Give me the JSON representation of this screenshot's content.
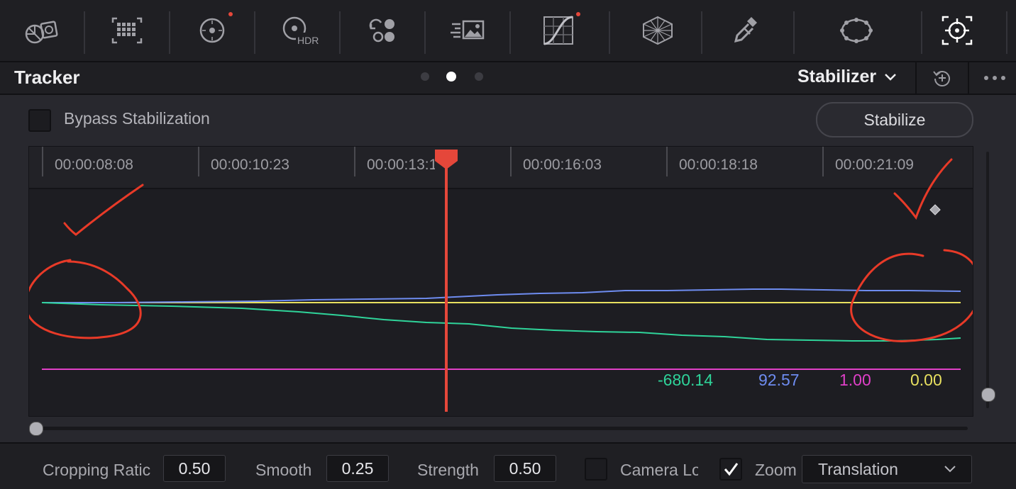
{
  "toolbar": {
    "tools": [
      {
        "icon": "camera-raw-icon",
        "badge": false
      },
      {
        "icon": "color-match-icon",
        "badge": false
      },
      {
        "icon": "color-wheels-icon",
        "badge": true
      },
      {
        "icon": "hdr-wheels-icon",
        "badge": false,
        "label": "HDR"
      },
      {
        "icon": "rgb-mixer-icon",
        "badge": false
      },
      {
        "icon": "motion-effects-icon",
        "badge": false
      },
      {
        "icon": "curves-icon",
        "badge": true
      },
      {
        "icon": "color-warper-icon",
        "badge": false
      },
      {
        "icon": "qualifier-icon",
        "badge": false
      },
      {
        "icon": "window-icon",
        "badge": false
      },
      {
        "icon": "tracker-icon",
        "badge": false,
        "active": true
      }
    ]
  },
  "header": {
    "title": "Tracker",
    "mode": "Stabilizer",
    "page_index": 1,
    "page_count": 3
  },
  "bypass": {
    "label": "Bypass Stabilization",
    "checked": false
  },
  "stabilize_button": "Stabilize",
  "timeline": {
    "timecodes": [
      "00:00:08:08",
      "00:00:10:23",
      "00:00:13:1",
      "00:00:16:03",
      "00:00:18:18",
      "00:00:21:09"
    ],
    "playhead_color": "#e5473a"
  },
  "graph": {
    "series": [
      {
        "color": "#2fd49a",
        "value": "-680.14"
      },
      {
        "color": "#6e8cf0",
        "value": "92.57"
      },
      {
        "color": "#e040c8",
        "value": "1.00"
      },
      {
        "color": "#e8e060",
        "value": "0.00"
      }
    ],
    "annotation_color": "#e83a28"
  },
  "controls": {
    "cropping_ratio": {
      "label": "Cropping Ratic",
      "value": "0.50"
    },
    "smooth": {
      "label": "Smooth",
      "value": "0.25"
    },
    "strength": {
      "label": "Strength",
      "value": "0.50"
    },
    "camera_lock": {
      "label": "Camera Lo",
      "checked": false
    },
    "zoom": {
      "label": "Zoom",
      "checked": true
    },
    "mode": {
      "value": "Translation"
    }
  }
}
